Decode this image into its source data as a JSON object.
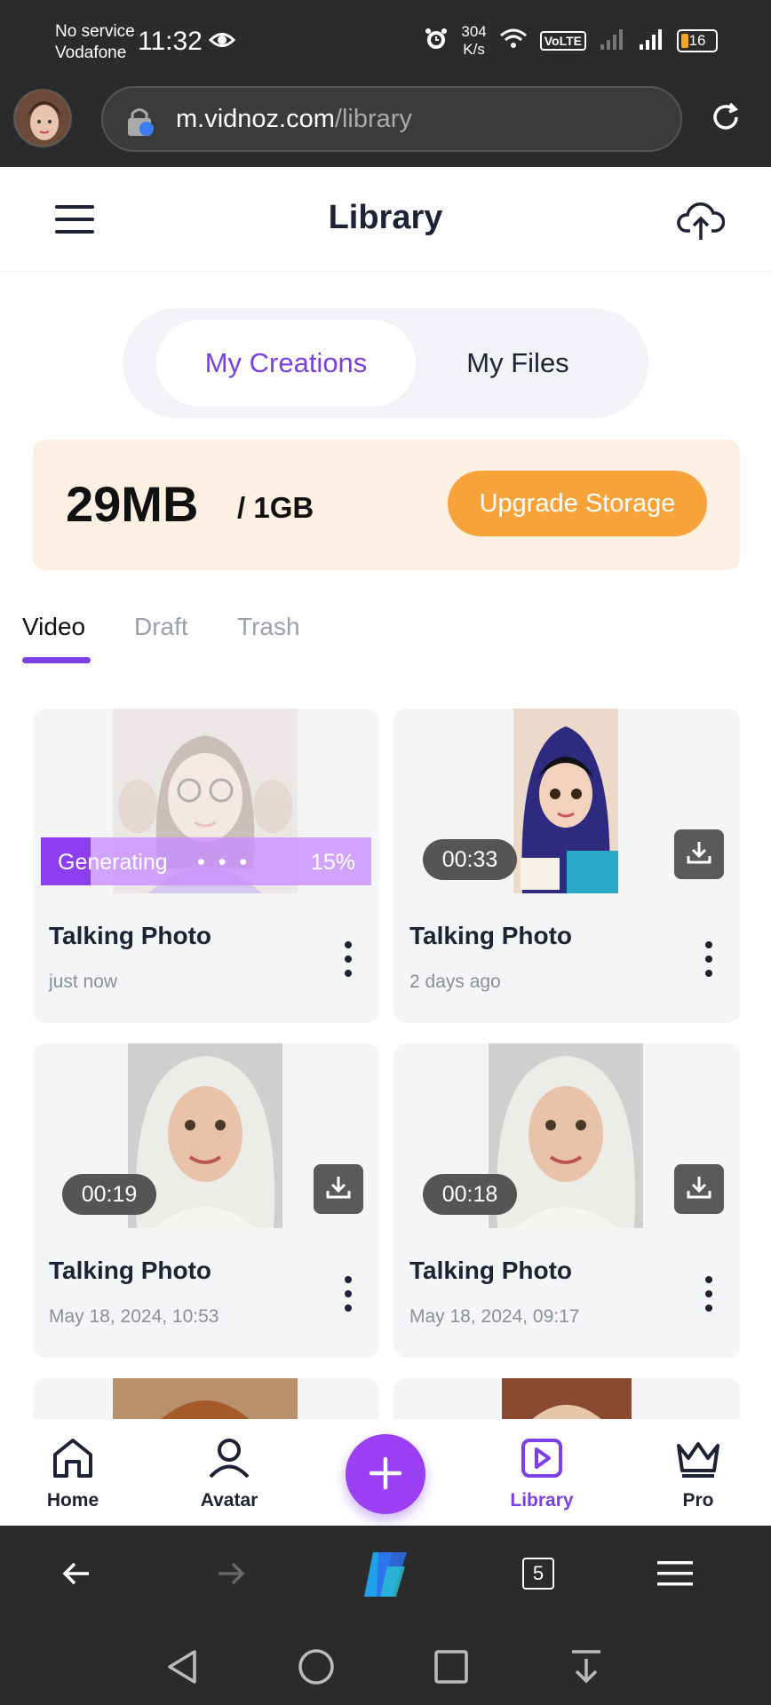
{
  "status_bar": {
    "carrier_line1": "No service",
    "carrier_line2": "Vodafone",
    "time": "11:32",
    "net_speed_value": "304",
    "net_speed_unit": "K/s",
    "volte": "VoLTE",
    "battery": "16"
  },
  "browser": {
    "url_host": "m.vidnoz.com",
    "url_path": "/library",
    "tab_count": "5"
  },
  "header": {
    "title": "Library"
  },
  "segment": {
    "active": "My Creations",
    "other": "My Files"
  },
  "storage": {
    "used": "29MB",
    "total": "/ 1GB",
    "upgrade_label": "Upgrade Storage"
  },
  "subtabs": [
    "Video",
    "Draft",
    "Trash"
  ],
  "cards": [
    {
      "title": "Talking Photo",
      "subtitle": "just now",
      "generating": true,
      "generating_label": "Generating",
      "progress_percent": 15,
      "progress_text": "15%"
    },
    {
      "title": "Talking Photo",
      "subtitle": "2 days ago",
      "duration": "00:33"
    },
    {
      "title": "Talking Photo",
      "subtitle": "May 18, 2024, 10:53",
      "duration": "00:19"
    },
    {
      "title": "Talking Photo",
      "subtitle": "May 18, 2024, 09:17",
      "duration": "00:18"
    }
  ],
  "bottom_nav": {
    "home": "Home",
    "avatar": "Avatar",
    "library": "Library",
    "pro": "Pro"
  },
  "colors": {
    "accent": "#7b3fe4",
    "upgrade": "#f7a33a",
    "storage_bg": "#fdf0e3",
    "dark_bar": "#2b2b2b"
  }
}
